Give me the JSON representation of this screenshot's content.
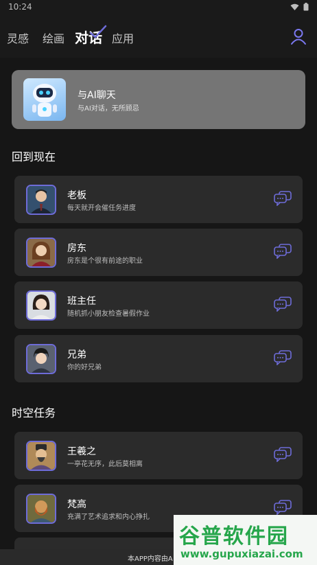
{
  "status_bar": {
    "time": "10:24"
  },
  "nav": {
    "tabs": [
      "灵感",
      "绘画",
      "对话",
      "应用"
    ],
    "active_index": 2
  },
  "hero": {
    "title": "与AI聊天",
    "subtitle": "与AI对话，无所顾忌"
  },
  "sections": [
    {
      "title": "回到现在",
      "items": [
        {
          "title": "老板",
          "subtitle": "每天就开会催任务进度"
        },
        {
          "title": "房东",
          "subtitle": "房东是个很有前途的职业"
        },
        {
          "title": "班主任",
          "subtitle": "随机抓小朋友检查暑假作业"
        },
        {
          "title": "兄弟",
          "subtitle": "你的好兄弟"
        }
      ]
    },
    {
      "title": "时空任务",
      "items": [
        {
          "title": "王羲之",
          "subtitle": "一亭花无序，此后莫相离"
        },
        {
          "title": "梵高",
          "subtitle": "充满了艺术追求和内心挣扎"
        }
      ]
    }
  ],
  "bottom_banner": {
    "text": "本APP内容由A"
  },
  "watermark": {
    "brand": "谷普软件园",
    "url": "www.gupuxiazai.com"
  },
  "colors": {
    "accent": "#6e6cd9",
    "background": "#161616",
    "card": "#2b2b2b",
    "hero_card": "#757575",
    "watermark_green": "#26a64b"
  }
}
